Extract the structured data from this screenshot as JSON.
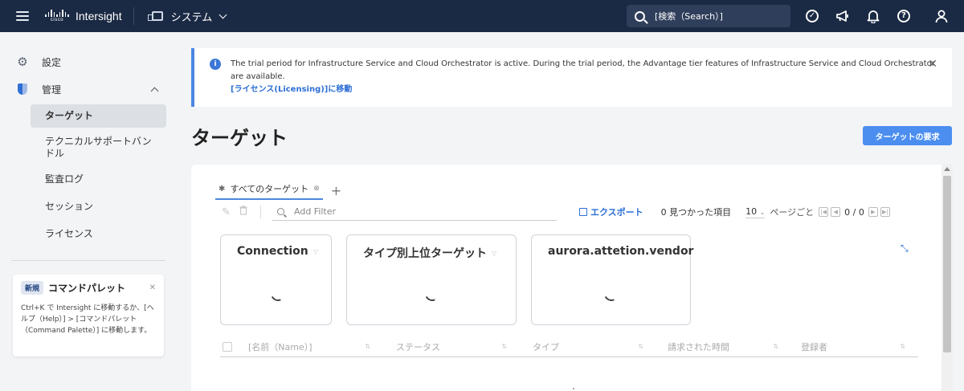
{
  "header": {
    "brand_mark": "cisco",
    "app_name": "Intersight",
    "context_label": "システム",
    "search_placeholder": "[検索（Search）]",
    "icons": [
      "check-circle-icon",
      "megaphone-icon",
      "bell-icon",
      "help-icon",
      "user-icon"
    ]
  },
  "sidebar": {
    "settings_label": "設定",
    "admin_label": "管理",
    "items": [
      {
        "label": "ターゲット",
        "active": true
      },
      {
        "label": "テクニカルサポートバンドル"
      },
      {
        "label": "監査ログ"
      },
      {
        "label": "セッション"
      },
      {
        "label": "ライセンス"
      }
    ],
    "palette": {
      "badge": "新規",
      "title": "コマンドパレット",
      "body": "Ctrl+K で Intersight に移動するか、[ヘルプ（Help）] > [コマンドパレット（Command Palette）] に移動します。"
    }
  },
  "alert": {
    "message": "The trial period for Infrastructure Service and Cloud Orchestrator is active. During the trial period, the Advantage tier features of Infrastructure Service and Cloud Orchestrator are available.",
    "link": "[ライセンス(Licensing)]に移動"
  },
  "page": {
    "title": "ターゲット",
    "claim_button": "ターゲットの要求"
  },
  "tabs": [
    {
      "label": "すべてのターゲット",
      "active": true
    }
  ],
  "toolbar": {
    "filter_placeholder": "Add Filter",
    "export_label": "エクスポート",
    "found_label": "0 見つかった項目",
    "page_size": "10",
    "per_page_label": "ページごと",
    "page_indicator": "0 / 0"
  },
  "widgets": [
    {
      "title": "Connection",
      "loading": true
    },
    {
      "title": "タイプ別上位ターゲット",
      "loading": true
    },
    {
      "title": "aurora.attetion.vendor",
      "loading": true
    }
  ],
  "table": {
    "columns": [
      "[名前（Name）]",
      "ステータス",
      "タイプ",
      "請求された時間",
      "登録者"
    ]
  },
  "colors": {
    "header_bg": "#1b2a44",
    "accent": "#4b87e0",
    "primary_button": "#4b8ef0",
    "link": "#2c6ed5"
  }
}
